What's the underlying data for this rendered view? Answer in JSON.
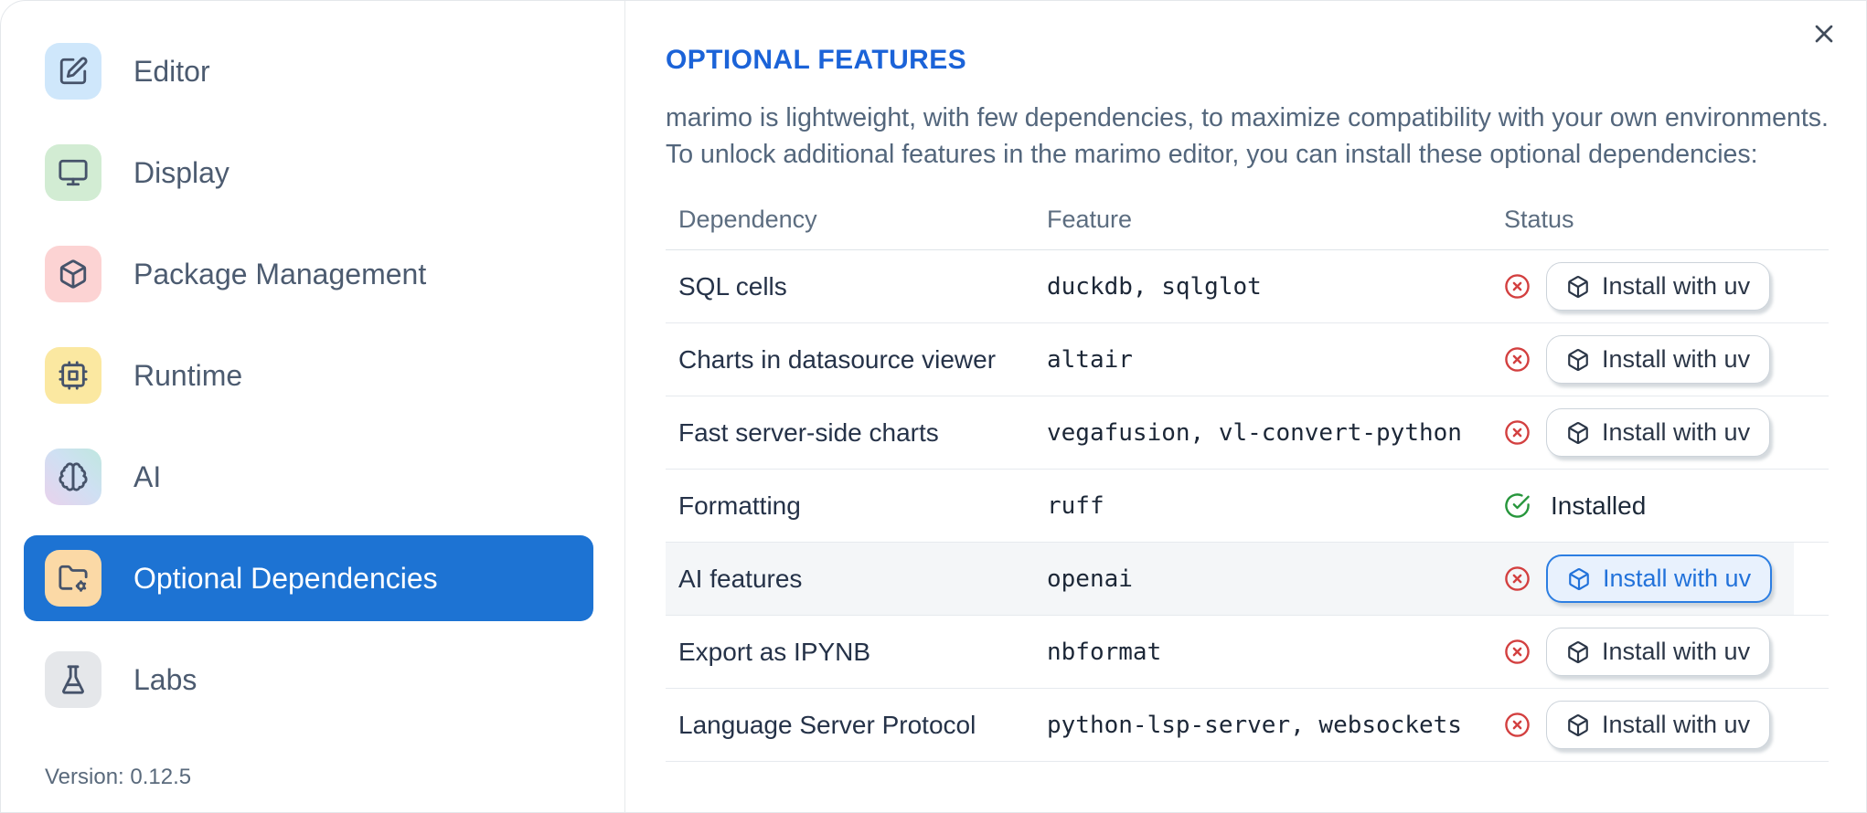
{
  "dialog": {
    "close_icon": "x-icon"
  },
  "sidebar": {
    "items": [
      {
        "label": "Editor",
        "icon": "edit-icon",
        "tile_color": "#cfe7fb",
        "selected": false
      },
      {
        "label": "Display",
        "icon": "monitor-icon",
        "tile_color": "#d2ecd3",
        "selected": false
      },
      {
        "label": "Package Management",
        "icon": "package-icon",
        "tile_color": "#fcd3d3",
        "selected": false
      },
      {
        "label": "Runtime",
        "icon": "cpu-icon",
        "tile_color": "#fbe8a1",
        "selected": false
      },
      {
        "label": "AI",
        "icon": "brain-icon",
        "tile_color": "linear-gradient(to top right, #e9d2ec, #cfe0f3 55%, #bfe7df)",
        "selected": false
      },
      {
        "label": "Optional Dependencies",
        "icon": "folder-cog-icon",
        "tile_color": "#fbd9a6",
        "selected": true
      },
      {
        "label": "Labs",
        "icon": "flask-icon",
        "tile_color": "#e5e7ea",
        "selected": false
      }
    ],
    "version_label": "Version: 0.12.5"
  },
  "main": {
    "title": "OPTIONAL FEATURES",
    "description_lines": [
      "marimo is lightweight, with few dependencies, to maximize compatibility with your own environments.",
      "To unlock additional features in the marimo editor, you can install these optional dependencies:"
    ],
    "table": {
      "headers": [
        "Dependency",
        "Feature",
        "Status"
      ],
      "rows": [
        {
          "dependency": "SQL cells",
          "feature": "duckdb, sqlglot",
          "installed": false,
          "status_icon": "circle-x-icon",
          "action": "Install with uv",
          "highlighted": false
        },
        {
          "dependency": "Charts in datasource viewer",
          "feature": "altair",
          "installed": false,
          "status_icon": "circle-x-icon",
          "action": "Install with uv",
          "highlighted": false
        },
        {
          "dependency": "Fast server-side charts",
          "feature": "vegafusion, vl-convert-python",
          "installed": false,
          "status_icon": "circle-x-icon",
          "action": "Install with uv",
          "highlighted": false
        },
        {
          "dependency": "Formatting",
          "feature": "ruff",
          "installed": true,
          "status_icon": "circle-check-icon",
          "status_text": "Installed",
          "highlighted": false
        },
        {
          "dependency": "AI features",
          "feature": "openai",
          "installed": false,
          "status_icon": "circle-x-icon",
          "action": "Install with uv",
          "highlighted": true
        },
        {
          "dependency": "Export as IPYNB",
          "feature": "nbformat",
          "installed": false,
          "status_icon": "circle-x-icon",
          "action": "Install with uv",
          "highlighted": false
        },
        {
          "dependency": "Language Server Protocol",
          "feature": "python-lsp-server, websockets",
          "installed": false,
          "status_icon": "circle-x-icon",
          "action": "Install with uv",
          "highlighted": false
        }
      ]
    }
  },
  "colors": {
    "selected_item_blue": "#1d73d3",
    "title_blue": "#1b63d8",
    "error_red": "#d34040",
    "success_green": "#27963c",
    "highlight_button_blue": "#2c7ee2"
  }
}
